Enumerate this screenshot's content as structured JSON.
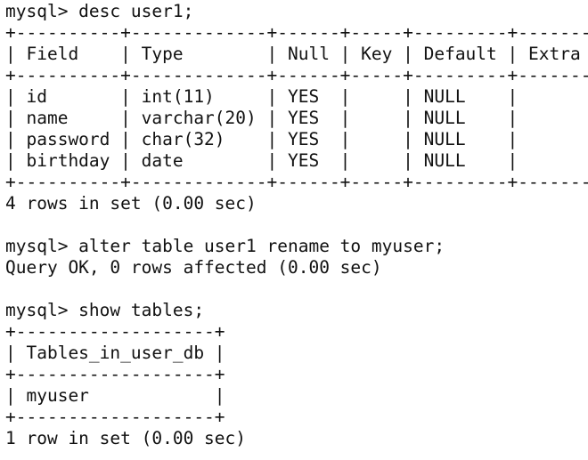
{
  "terminal": {
    "lines": [
      "mysql> desc user1;",
      "+----------+-------------+------+-----+---------+-------+",
      "| Field    | Type        | Null | Key | Default | Extra |",
      "+----------+-------------+------+-----+---------+-------+",
      "| id       | int(11)     | YES  |     | NULL    |       |",
      "| name     | varchar(20) | YES  |     | NULL    |       |",
      "| password | char(32)    | YES  |     | NULL    |       |",
      "| birthday | date        | YES  |     | NULL    |       |",
      "+----------+-------------+------+-----+---------+-------+",
      "4 rows in set (0.00 sec)",
      "",
      "mysql> alter table user1 rename to myuser;",
      "Query OK, 0 rows affected (0.00 sec)",
      "",
      "mysql> show tables;",
      "+-------------------+",
      "| Tables_in_user_db |",
      "+-------------------+",
      "| myuser            |",
      "+-------------------+",
      "1 row in set (0.00 sec)"
    ]
  }
}
